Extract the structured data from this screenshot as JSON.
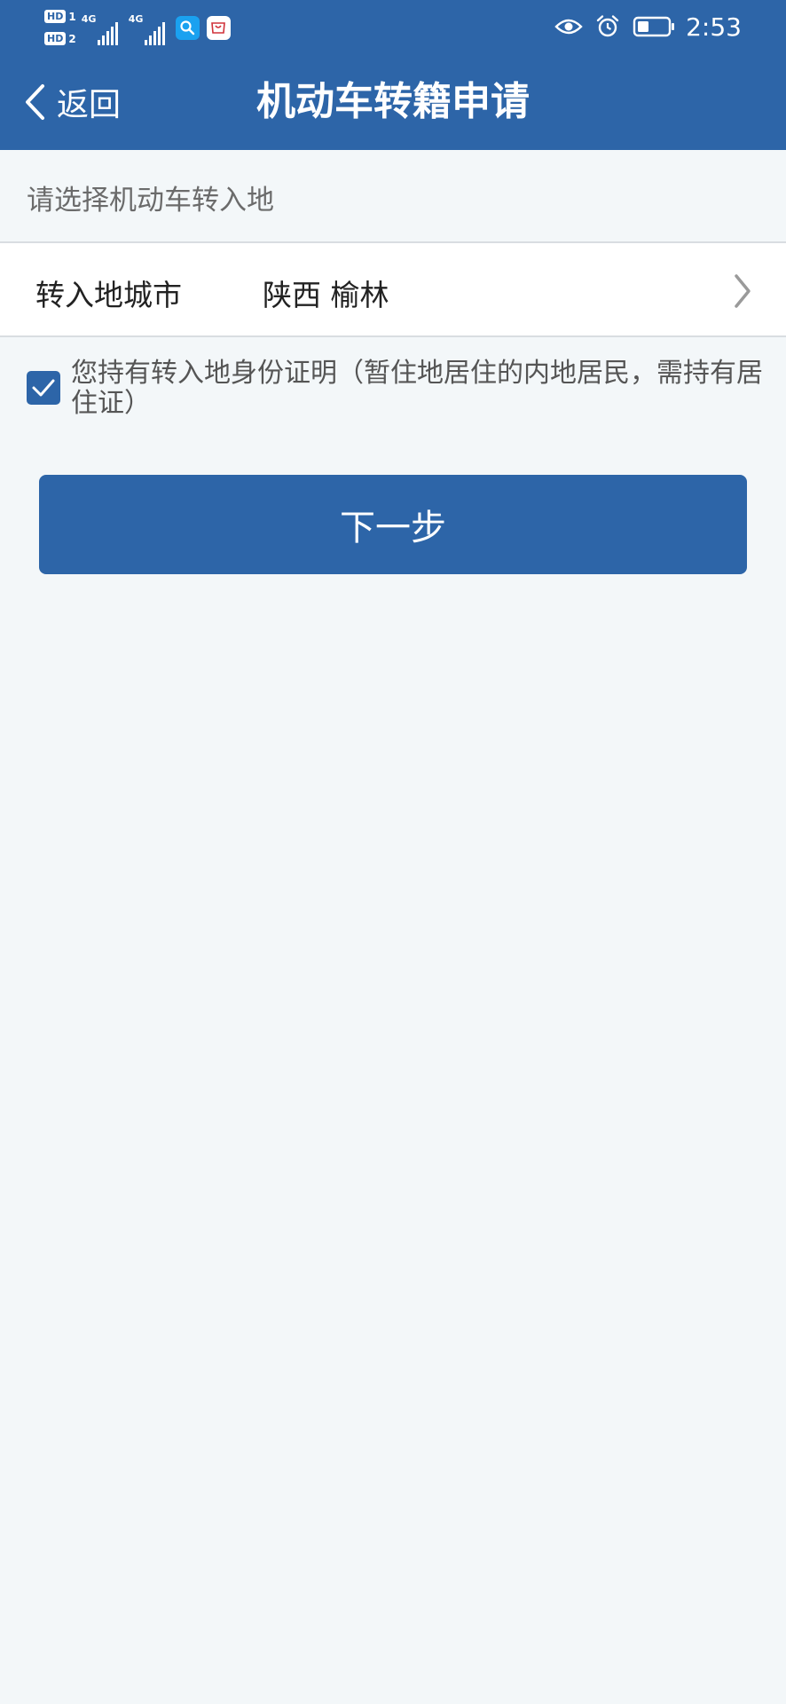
{
  "status_bar": {
    "sim1_badge": "HD",
    "sim1_number": "1",
    "sim2_badge": "HD",
    "sim2_number": "2",
    "network1_label": "4G",
    "network2_label": "4G",
    "time": "2:53",
    "icons": [
      "signal-icon",
      "signal-icon",
      "search-app-icon",
      "huawei-store-icon",
      "eye-icon",
      "alarm-icon",
      "battery-icon"
    ]
  },
  "nav": {
    "back_label": "返回",
    "title": "机动车转籍申请"
  },
  "form": {
    "section_label": "请选择机动车转入地",
    "city_label": "转入地城市",
    "city_value": "陕西 榆林",
    "consent_checked": true,
    "consent_text": "您持有转入地身份证明（暂住地居住的内地居民，需持有居住证）"
  },
  "actions": {
    "next_label": "下一步"
  },
  "colors": {
    "primary": "#2d65a8",
    "background": "#f3f7f9",
    "surface": "#ffffff",
    "divider": "#d9dde1"
  }
}
